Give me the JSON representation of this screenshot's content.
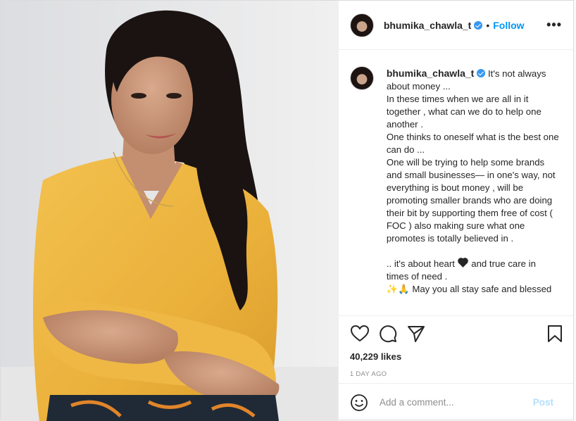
{
  "post": {
    "author": "bhumika_chawla_t",
    "follow_label": "Follow",
    "dot": "•",
    "more_label": "•••",
    "caption_lines": [
      "It's not always about money ...",
      "In these times when we are all in it together , what can we do to help one another .",
      "One thinks to oneself what is the best one can do ...",
      "One will be trying to help some brands and small businesses— in one's way, not everything is bout money , will be promoting smaller brands who are doing their bit by supporting them free of cost ( FOC ) also making sure what one promotes is totally believed in ."
    ],
    "closing_before_heart": ".. it's about heart",
    "closing_after_heart": "and true care in times of need .",
    "closing_emoji": "✨🙏",
    "closing_last": "May you all stay safe and blessed",
    "likes": "40,229 likes",
    "time": "1 DAY AGO",
    "comment_placeholder": "Add a comment...",
    "post_button": "Post"
  },
  "icons": {
    "like": "heart-icon",
    "comment": "comment-icon",
    "share": "share-icon",
    "save": "bookmark-icon",
    "emoji": "smiley-icon",
    "verified": "verified-badge-icon"
  },
  "colors": {
    "accent": "#0095f6",
    "verified": "#3897f0",
    "post_disabled": "#b2dffc",
    "shirt": "#f0b840"
  }
}
